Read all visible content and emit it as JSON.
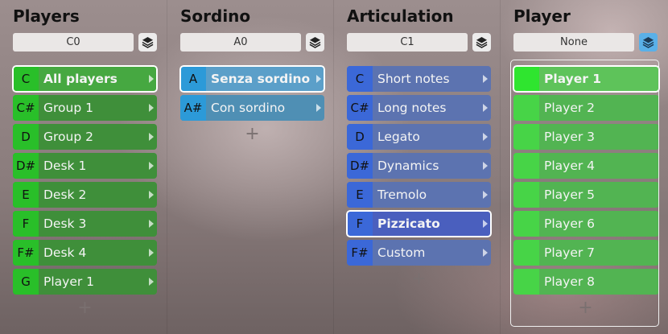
{
  "columns": [
    {
      "title": "Players",
      "preset": "C0",
      "items": [
        {
          "key": "C",
          "label": "All players",
          "selected": true
        },
        {
          "key": "C#",
          "label": "Group 1"
        },
        {
          "key": "D",
          "label": "Group 2"
        },
        {
          "key": "D#",
          "label": "Desk 1"
        },
        {
          "key": "E",
          "label": "Desk 2"
        },
        {
          "key": "F",
          "label": "Desk 3"
        },
        {
          "key": "F#",
          "label": "Desk 4"
        },
        {
          "key": "G",
          "label": "Player 1"
        }
      ],
      "add": "+"
    },
    {
      "title": "Sordino",
      "preset": "A0",
      "items": [
        {
          "key": "A",
          "label": "Senza sordino",
          "selected": true
        },
        {
          "key": "A#",
          "label": "Con sordino"
        }
      ],
      "add": "+"
    },
    {
      "title": "Articulation",
      "preset": "C1",
      "items": [
        {
          "key": "C",
          "label": "Short notes"
        },
        {
          "key": "C#",
          "label": "Long notes"
        },
        {
          "key": "D",
          "label": "Legato"
        },
        {
          "key": "D#",
          "label": "Dynamics"
        },
        {
          "key": "E",
          "label": "Tremolo"
        },
        {
          "key": "F",
          "label": "Pizzicato",
          "selected": true
        },
        {
          "key": "F#",
          "label": "Custom"
        }
      ],
      "add": "+"
    },
    {
      "title": "Player",
      "preset": "None",
      "items": [
        {
          "key": "",
          "label": "Player 1",
          "selected": true
        },
        {
          "key": "",
          "label": "Player 2"
        },
        {
          "key": "",
          "label": "Player 3"
        },
        {
          "key": "",
          "label": "Player 4"
        },
        {
          "key": "",
          "label": "Player 5"
        },
        {
          "key": "",
          "label": "Player 6"
        },
        {
          "key": "",
          "label": "Player 7"
        },
        {
          "key": "",
          "label": "Player 8"
        }
      ],
      "add": "+"
    }
  ],
  "colors": {
    "players": "#3f8f3a",
    "sordino": "#4f8fb4",
    "articulation": "#5c73b0",
    "player": "#52b452",
    "layers_active": "#5ab0e8"
  }
}
